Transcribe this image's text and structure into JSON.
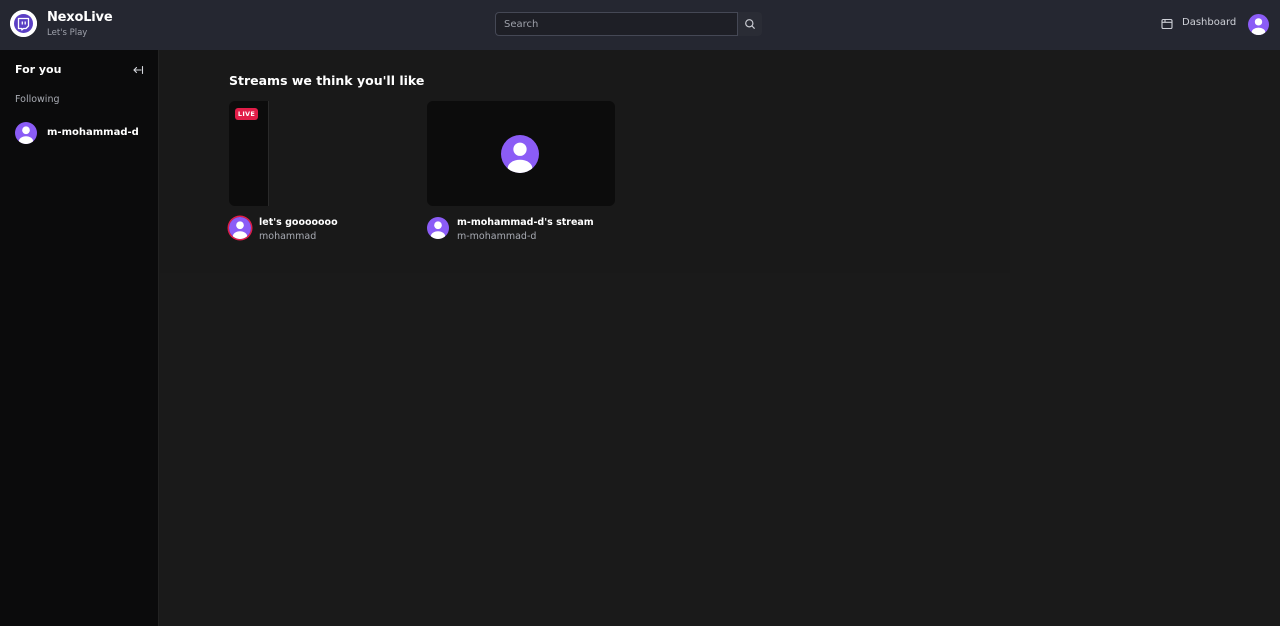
{
  "brand": {
    "title": "NexoLive",
    "subtitle": "Let's Play"
  },
  "search": {
    "placeholder": "Search",
    "value": ""
  },
  "header": {
    "dashboard_label": "Dashboard"
  },
  "sidebar": {
    "title": "For you",
    "following_label": "Following",
    "following": [
      {
        "name": "m-mohammad-d"
      }
    ]
  },
  "main": {
    "section_title": "Streams we think you'll like",
    "streams": [
      {
        "title": "let's gooooooo",
        "user": "mohammad",
        "live": true,
        "live_label": "LIVE"
      },
      {
        "title": "m-mohammad-d's stream",
        "user": "m-mohammad-d",
        "live": false
      }
    ]
  },
  "colors": {
    "accent": "#7c3aed",
    "live": "#e11d48",
    "header_bg": "#252731",
    "sidebar_bg": "#0b0b0c",
    "main_bg": "#1a1a1a"
  },
  "icons": [
    "logo-icon",
    "search-icon",
    "dashboard-icon",
    "collapse-sidebar-icon",
    "user-avatar-icon"
  ]
}
